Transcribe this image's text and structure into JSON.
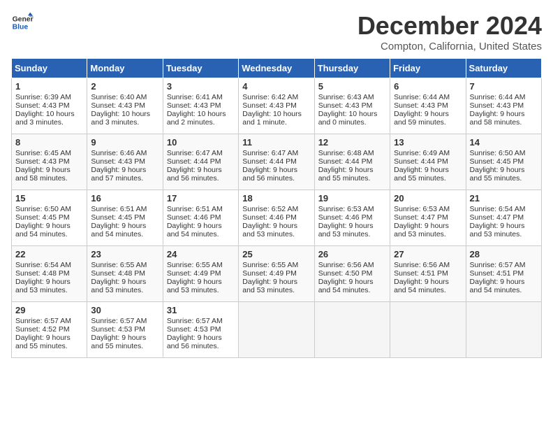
{
  "logo": {
    "line1": "General",
    "line2": "Blue"
  },
  "title": "December 2024",
  "subtitle": "Compton, California, United States",
  "days_of_week": [
    "Sunday",
    "Monday",
    "Tuesday",
    "Wednesday",
    "Thursday",
    "Friday",
    "Saturday"
  ],
  "weeks": [
    [
      {
        "day": 1,
        "lines": [
          "Sunrise: 6:39 AM",
          "Sunset: 4:43 PM",
          "Daylight: 10 hours",
          "and 3 minutes."
        ]
      },
      {
        "day": 2,
        "lines": [
          "Sunrise: 6:40 AM",
          "Sunset: 4:43 PM",
          "Daylight: 10 hours",
          "and 3 minutes."
        ]
      },
      {
        "day": 3,
        "lines": [
          "Sunrise: 6:41 AM",
          "Sunset: 4:43 PM",
          "Daylight: 10 hours",
          "and 2 minutes."
        ]
      },
      {
        "day": 4,
        "lines": [
          "Sunrise: 6:42 AM",
          "Sunset: 4:43 PM",
          "Daylight: 10 hours",
          "and 1 minute."
        ]
      },
      {
        "day": 5,
        "lines": [
          "Sunrise: 6:43 AM",
          "Sunset: 4:43 PM",
          "Daylight: 10 hours",
          "and 0 minutes."
        ]
      },
      {
        "day": 6,
        "lines": [
          "Sunrise: 6:44 AM",
          "Sunset: 4:43 PM",
          "Daylight: 9 hours",
          "and 59 minutes."
        ]
      },
      {
        "day": 7,
        "lines": [
          "Sunrise: 6:44 AM",
          "Sunset: 4:43 PM",
          "Daylight: 9 hours",
          "and 58 minutes."
        ]
      }
    ],
    [
      {
        "day": 8,
        "lines": [
          "Sunrise: 6:45 AM",
          "Sunset: 4:43 PM",
          "Daylight: 9 hours",
          "and 58 minutes."
        ]
      },
      {
        "day": 9,
        "lines": [
          "Sunrise: 6:46 AM",
          "Sunset: 4:43 PM",
          "Daylight: 9 hours",
          "and 57 minutes."
        ]
      },
      {
        "day": 10,
        "lines": [
          "Sunrise: 6:47 AM",
          "Sunset: 4:44 PM",
          "Daylight: 9 hours",
          "and 56 minutes."
        ]
      },
      {
        "day": 11,
        "lines": [
          "Sunrise: 6:47 AM",
          "Sunset: 4:44 PM",
          "Daylight: 9 hours",
          "and 56 minutes."
        ]
      },
      {
        "day": 12,
        "lines": [
          "Sunrise: 6:48 AM",
          "Sunset: 4:44 PM",
          "Daylight: 9 hours",
          "and 55 minutes."
        ]
      },
      {
        "day": 13,
        "lines": [
          "Sunrise: 6:49 AM",
          "Sunset: 4:44 PM",
          "Daylight: 9 hours",
          "and 55 minutes."
        ]
      },
      {
        "day": 14,
        "lines": [
          "Sunrise: 6:50 AM",
          "Sunset: 4:45 PM",
          "Daylight: 9 hours",
          "and 55 minutes."
        ]
      }
    ],
    [
      {
        "day": 15,
        "lines": [
          "Sunrise: 6:50 AM",
          "Sunset: 4:45 PM",
          "Daylight: 9 hours",
          "and 54 minutes."
        ]
      },
      {
        "day": 16,
        "lines": [
          "Sunrise: 6:51 AM",
          "Sunset: 4:45 PM",
          "Daylight: 9 hours",
          "and 54 minutes."
        ]
      },
      {
        "day": 17,
        "lines": [
          "Sunrise: 6:51 AM",
          "Sunset: 4:46 PM",
          "Daylight: 9 hours",
          "and 54 minutes."
        ]
      },
      {
        "day": 18,
        "lines": [
          "Sunrise: 6:52 AM",
          "Sunset: 4:46 PM",
          "Daylight: 9 hours",
          "and 53 minutes."
        ]
      },
      {
        "day": 19,
        "lines": [
          "Sunrise: 6:53 AM",
          "Sunset: 4:46 PM",
          "Daylight: 9 hours",
          "and 53 minutes."
        ]
      },
      {
        "day": 20,
        "lines": [
          "Sunrise: 6:53 AM",
          "Sunset: 4:47 PM",
          "Daylight: 9 hours",
          "and 53 minutes."
        ]
      },
      {
        "day": 21,
        "lines": [
          "Sunrise: 6:54 AM",
          "Sunset: 4:47 PM",
          "Daylight: 9 hours",
          "and 53 minutes."
        ]
      }
    ],
    [
      {
        "day": 22,
        "lines": [
          "Sunrise: 6:54 AM",
          "Sunset: 4:48 PM",
          "Daylight: 9 hours",
          "and 53 minutes."
        ]
      },
      {
        "day": 23,
        "lines": [
          "Sunrise: 6:55 AM",
          "Sunset: 4:48 PM",
          "Daylight: 9 hours",
          "and 53 minutes."
        ]
      },
      {
        "day": 24,
        "lines": [
          "Sunrise: 6:55 AM",
          "Sunset: 4:49 PM",
          "Daylight: 9 hours",
          "and 53 minutes."
        ]
      },
      {
        "day": 25,
        "lines": [
          "Sunrise: 6:55 AM",
          "Sunset: 4:49 PM",
          "Daylight: 9 hours",
          "and 53 minutes."
        ]
      },
      {
        "day": 26,
        "lines": [
          "Sunrise: 6:56 AM",
          "Sunset: 4:50 PM",
          "Daylight: 9 hours",
          "and 54 minutes."
        ]
      },
      {
        "day": 27,
        "lines": [
          "Sunrise: 6:56 AM",
          "Sunset: 4:51 PM",
          "Daylight: 9 hours",
          "and 54 minutes."
        ]
      },
      {
        "day": 28,
        "lines": [
          "Sunrise: 6:57 AM",
          "Sunset: 4:51 PM",
          "Daylight: 9 hours",
          "and 54 minutes."
        ]
      }
    ],
    [
      {
        "day": 29,
        "lines": [
          "Sunrise: 6:57 AM",
          "Sunset: 4:52 PM",
          "Daylight: 9 hours",
          "and 55 minutes."
        ]
      },
      {
        "day": 30,
        "lines": [
          "Sunrise: 6:57 AM",
          "Sunset: 4:53 PM",
          "Daylight: 9 hours",
          "and 55 minutes."
        ]
      },
      {
        "day": 31,
        "lines": [
          "Sunrise: 6:57 AM",
          "Sunset: 4:53 PM",
          "Daylight: 9 hours",
          "and 56 minutes."
        ]
      },
      null,
      null,
      null,
      null
    ]
  ]
}
